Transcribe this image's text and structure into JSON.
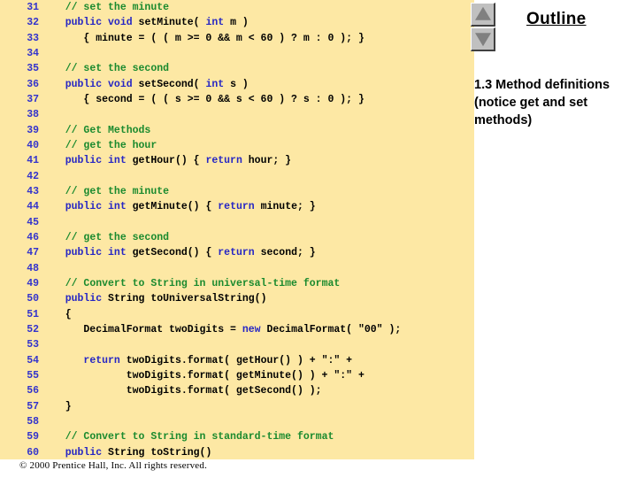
{
  "code_panel": {
    "background_color": "#fde8a4",
    "line_number_color": "#3333cc",
    "comment_color": "#1a8a2e",
    "keyword_color": "#2626c4",
    "lines": [
      {
        "num": "31",
        "segments": [
          {
            "text": "   ",
            "cls": "plain"
          },
          {
            "text": "// set the minute",
            "cls": "cmt"
          }
        ]
      },
      {
        "num": "32",
        "segments": [
          {
            "text": "   ",
            "cls": "plain"
          },
          {
            "text": "public void",
            "cls": "kw"
          },
          {
            "text": " setMinute( ",
            "cls": "plain"
          },
          {
            "text": "int",
            "cls": "kw"
          },
          {
            "text": " m )",
            "cls": "plain"
          }
        ]
      },
      {
        "num": "33",
        "segments": [
          {
            "text": "      { minute = ( ( m >= 0 && m < 60 ) ? m : 0 ); }",
            "cls": "plain"
          }
        ]
      },
      {
        "num": "34",
        "segments": [
          {
            "text": "",
            "cls": "plain"
          }
        ]
      },
      {
        "num": "35",
        "segments": [
          {
            "text": "   ",
            "cls": "plain"
          },
          {
            "text": "// set the second",
            "cls": "cmt"
          }
        ]
      },
      {
        "num": "36",
        "segments": [
          {
            "text": "   ",
            "cls": "plain"
          },
          {
            "text": "public void",
            "cls": "kw"
          },
          {
            "text": " setSecond( ",
            "cls": "plain"
          },
          {
            "text": "int",
            "cls": "kw"
          },
          {
            "text": " s )",
            "cls": "plain"
          }
        ]
      },
      {
        "num": "37",
        "segments": [
          {
            "text": "      { second = ( ( s >= 0 && s < 60 ) ? s : 0 ); }",
            "cls": "plain"
          }
        ]
      },
      {
        "num": "38",
        "segments": [
          {
            "text": "",
            "cls": "plain"
          }
        ]
      },
      {
        "num": "39",
        "segments": [
          {
            "text": "   ",
            "cls": "plain"
          },
          {
            "text": "// Get Methods",
            "cls": "cmt"
          }
        ]
      },
      {
        "num": "40",
        "segments": [
          {
            "text": "   ",
            "cls": "plain"
          },
          {
            "text": "// get the hour",
            "cls": "cmt"
          }
        ]
      },
      {
        "num": "41",
        "segments": [
          {
            "text": "   ",
            "cls": "plain"
          },
          {
            "text": "public int",
            "cls": "kw"
          },
          {
            "text": " getHour() { ",
            "cls": "plain"
          },
          {
            "text": "return",
            "cls": "kw"
          },
          {
            "text": " hour; }",
            "cls": "plain"
          }
        ]
      },
      {
        "num": "42",
        "segments": [
          {
            "text": "",
            "cls": "plain"
          }
        ]
      },
      {
        "num": "43",
        "segments": [
          {
            "text": "   ",
            "cls": "plain"
          },
          {
            "text": "// get the minute",
            "cls": "cmt"
          }
        ]
      },
      {
        "num": "44",
        "segments": [
          {
            "text": "   ",
            "cls": "plain"
          },
          {
            "text": "public int",
            "cls": "kw"
          },
          {
            "text": " getMinute() { ",
            "cls": "plain"
          },
          {
            "text": "return",
            "cls": "kw"
          },
          {
            "text": " minute; }",
            "cls": "plain"
          }
        ]
      },
      {
        "num": "45",
        "segments": [
          {
            "text": "",
            "cls": "plain"
          }
        ]
      },
      {
        "num": "46",
        "segments": [
          {
            "text": "   ",
            "cls": "plain"
          },
          {
            "text": "// get the second",
            "cls": "cmt"
          }
        ]
      },
      {
        "num": "47",
        "segments": [
          {
            "text": "   ",
            "cls": "plain"
          },
          {
            "text": "public int",
            "cls": "kw"
          },
          {
            "text": " getSecond() { ",
            "cls": "plain"
          },
          {
            "text": "return",
            "cls": "kw"
          },
          {
            "text": " second; }",
            "cls": "plain"
          }
        ]
      },
      {
        "num": "48",
        "segments": [
          {
            "text": "",
            "cls": "plain"
          }
        ]
      },
      {
        "num": "49",
        "segments": [
          {
            "text": "   ",
            "cls": "plain"
          },
          {
            "text": "// Convert to String in universal-time format",
            "cls": "cmt"
          }
        ]
      },
      {
        "num": "50",
        "segments": [
          {
            "text": "   ",
            "cls": "plain"
          },
          {
            "text": "public",
            "cls": "kw"
          },
          {
            "text": " String toUniversalString()",
            "cls": "plain"
          }
        ]
      },
      {
        "num": "51",
        "segments": [
          {
            "text": "   {",
            "cls": "plain"
          }
        ]
      },
      {
        "num": "52",
        "segments": [
          {
            "text": "      DecimalFormat twoDigits = ",
            "cls": "plain"
          },
          {
            "text": "new",
            "cls": "kw"
          },
          {
            "text": " DecimalFormat( \"00\" );",
            "cls": "plain"
          }
        ]
      },
      {
        "num": "53",
        "segments": [
          {
            "text": "",
            "cls": "plain"
          }
        ]
      },
      {
        "num": "54",
        "segments": [
          {
            "text": "      ",
            "cls": "plain"
          },
          {
            "text": "return",
            "cls": "kw"
          },
          {
            "text": " twoDigits.format( getHour() ) + \":\" +",
            "cls": "plain"
          }
        ]
      },
      {
        "num": "55",
        "segments": [
          {
            "text": "             twoDigits.format( getMinute() ) + \":\" +",
            "cls": "plain"
          }
        ]
      },
      {
        "num": "56",
        "segments": [
          {
            "text": "             twoDigits.format( getSecond() );",
            "cls": "plain"
          }
        ]
      },
      {
        "num": "57",
        "segments": [
          {
            "text": "   }",
            "cls": "plain"
          }
        ]
      },
      {
        "num": "58",
        "segments": [
          {
            "text": "",
            "cls": "plain"
          }
        ]
      },
      {
        "num": "59",
        "segments": [
          {
            "text": "   ",
            "cls": "plain"
          },
          {
            "text": "// Convert to String in standard-time format",
            "cls": "cmt"
          }
        ]
      },
      {
        "num": "60",
        "segments": [
          {
            "text": "   ",
            "cls": "plain"
          },
          {
            "text": "public",
            "cls": "kw"
          },
          {
            "text": " String toString()",
            "cls": "plain"
          }
        ]
      }
    ]
  },
  "footer": {
    "copyright": "© 2000 Prentice Hall, Inc.  All rights reserved."
  },
  "outline": {
    "title": "Outline",
    "scroll_up_label": "scroll-up",
    "scroll_down_label": "scroll-down",
    "entries": [
      "1.3 Method definitions",
      "(notice get and set",
      "methods)"
    ]
  }
}
